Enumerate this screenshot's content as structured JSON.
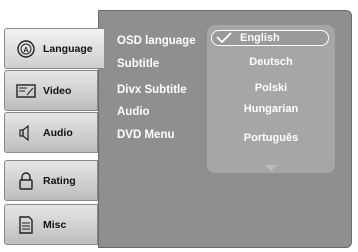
{
  "tabs": [
    {
      "label": "Language",
      "icon": "language-icon",
      "active": true
    },
    {
      "label": "Video",
      "icon": "video-icon",
      "active": false
    },
    {
      "label": "Audio",
      "icon": "speaker-icon",
      "active": false
    },
    {
      "label": "Rating",
      "icon": "lock-icon",
      "active": false
    },
    {
      "label": "Misc",
      "icon": "document-icon",
      "active": false
    }
  ],
  "menu": {
    "items": [
      "OSD language",
      "Subtitle",
      "Divx Subtitle",
      "Audio",
      "DVD Menu"
    ]
  },
  "dropdown": {
    "options": [
      "English",
      "Deutsch",
      "Polski",
      "Hungarian",
      "Português"
    ],
    "selected": "English"
  },
  "colors": {
    "panel": "#8f8f8f",
    "dropdown": "#a6a6a6",
    "text": "#ffffff"
  }
}
